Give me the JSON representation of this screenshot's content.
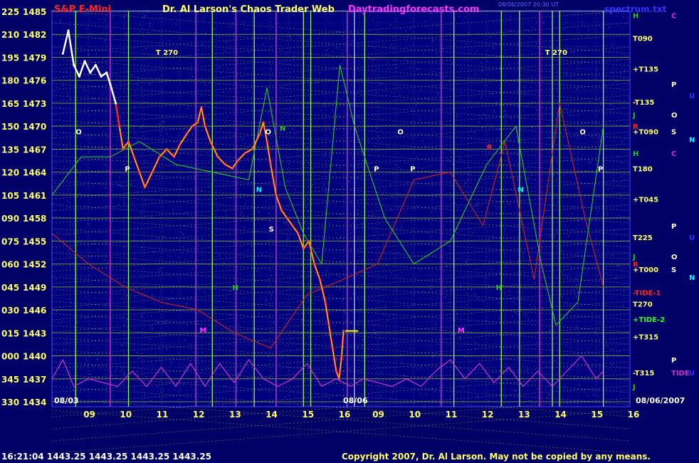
{
  "header": {
    "title_left": "S&P E-Mini",
    "title_center": "Dr. Al Larson's Chaos Trader Web",
    "site": "Daytradingforecasts.com",
    "timestamp": "08/06/2007 20:30 UT",
    "right_label": "spectrum.txt"
  },
  "footer": {
    "quote": "16:21:04  1443.25 1443.25 1443.25 1443.25",
    "copyright": "Copyright 2007, Dr. Al Larson. May not be copied by any means."
  },
  "colors": {
    "background": "#000066",
    "plot_area": "#00007f",
    "grid_horizontal": "#ccff00",
    "grid_vertical_lime": "#88ff44",
    "grid_vertical_magenta": "#cc33cc",
    "price_white": "#ffffff",
    "price_red": "#ff2222",
    "price_yellow": "#ffff00",
    "trace_green": "#22cc22",
    "trace_darkred": "#cc2222",
    "spectrum_magenta": "#cc33cc",
    "title_red": "#ff2222",
    "title_yellow": "#ffff66",
    "site_magenta": "#ff33ff"
  },
  "chart_data": {
    "type": "line",
    "title": "S&P E-Mini",
    "ylim": [
      1434,
      1485
    ],
    "ylabels": [
      {
        "angle": "225",
        "price": "1485",
        "value": 1485
      },
      {
        "angle": "210",
        "price": "1482",
        "value": 1482
      },
      {
        "angle": "195",
        "price": "1479",
        "value": 1479
      },
      {
        "angle": "180",
        "price": "1476",
        "value": 1476
      },
      {
        "angle": "165",
        "price": "1473",
        "value": 1473
      },
      {
        "angle": "150",
        "price": "1470",
        "value": 1470
      },
      {
        "angle": "135",
        "price": "1467",
        "value": 1467
      },
      {
        "angle": "120",
        "price": "1464",
        "value": 1464
      },
      {
        "angle": "105",
        "price": "1461",
        "value": 1461
      },
      {
        "angle": "090",
        "price": "1458",
        "value": 1458
      },
      {
        "angle": "075",
        "price": "1455",
        "value": 1455
      },
      {
        "angle": "060",
        "price": "1452",
        "value": 1452
      },
      {
        "angle": "045",
        "price": "1449",
        "value": 1449
      },
      {
        "angle": "030",
        "price": "1446",
        "value": 1446
      },
      {
        "angle": "015",
        "price": "1443",
        "value": 1443
      },
      {
        "angle": "000",
        "price": "1440",
        "value": 1440
      },
      {
        "angle": "345",
        "price": "1437",
        "value": 1437
      },
      {
        "angle": "330",
        "price": "1434",
        "value": 1434
      }
    ],
    "x_sessions": [
      {
        "date": "08/03",
        "hours": [
          "09",
          "10",
          "11",
          "12",
          "13",
          "14",
          "15",
          "16"
        ]
      },
      {
        "date": "08/06",
        "hours": [
          "09",
          "10",
          "11",
          "12",
          "13",
          "14",
          "15",
          "16"
        ]
      }
    ],
    "x_corner_label": "08/06/2007",
    "last_price": 1443.25,
    "price_series": [
      {
        "t": 8.3,
        "v": 1479.5
      },
      {
        "t": 8.45,
        "v": 1482.5
      },
      {
        "t": 8.6,
        "v": 1478
      },
      {
        "t": 8.75,
        "v": 1476.5
      },
      {
        "t": 8.9,
        "v": 1478.5
      },
      {
        "t": 9.05,
        "v": 1477
      },
      {
        "t": 9.2,
        "v": 1478
      },
      {
        "t": 9.35,
        "v": 1476.5
      },
      {
        "t": 9.5,
        "v": 1477
      },
      {
        "t": 9.6,
        "v": 1475.5
      },
      {
        "t": 9.75,
        "v": 1473
      },
      {
        "t": 9.85,
        "v": 1470
      },
      {
        "t": 9.95,
        "v": 1467
      },
      {
        "t": 10.1,
        "v": 1468
      },
      {
        "t": 10.25,
        "v": 1466
      },
      {
        "t": 10.4,
        "v": 1464
      },
      {
        "t": 10.55,
        "v": 1462
      },
      {
        "t": 10.75,
        "v": 1464
      },
      {
        "t": 10.95,
        "v": 1466
      },
      {
        "t": 11.15,
        "v": 1467
      },
      {
        "t": 11.35,
        "v": 1466
      },
      {
        "t": 11.5,
        "v": 1467.5
      },
      {
        "t": 11.7,
        "v": 1469
      },
      {
        "t": 11.85,
        "v": 1470
      },
      {
        "t": 12.0,
        "v": 1470.5
      },
      {
        "t": 12.1,
        "v": 1472.5
      },
      {
        "t": 12.2,
        "v": 1470
      },
      {
        "t": 12.35,
        "v": 1468
      },
      {
        "t": 12.55,
        "v": 1466
      },
      {
        "t": 12.75,
        "v": 1465
      },
      {
        "t": 12.95,
        "v": 1464.5
      },
      {
        "t": 13.1,
        "v": 1465.5
      },
      {
        "t": 13.3,
        "v": 1466.5
      },
      {
        "t": 13.5,
        "v": 1467
      },
      {
        "t": 13.7,
        "v": 1469
      },
      {
        "t": 13.8,
        "v": 1470.5
      },
      {
        "t": 13.9,
        "v": 1468
      },
      {
        "t": 14.0,
        "v": 1465
      },
      {
        "t": 14.15,
        "v": 1461
      },
      {
        "t": 14.3,
        "v": 1459
      },
      {
        "t": 14.45,
        "v": 1458
      },
      {
        "t": 14.6,
        "v": 1457
      },
      {
        "t": 14.75,
        "v": 1456
      },
      {
        "t": 14.9,
        "v": 1454
      },
      {
        "t": 15.05,
        "v": 1455
      },
      {
        "t": 15.2,
        "v": 1452
      },
      {
        "t": 15.35,
        "v": 1450
      },
      {
        "t": 15.5,
        "v": 1447
      },
      {
        "t": 15.6,
        "v": 1444
      },
      {
        "t": 15.7,
        "v": 1441
      },
      {
        "t": 15.8,
        "v": 1438
      },
      {
        "t": 15.88,
        "v": 1437
      },
      {
        "t": 15.95,
        "v": 1440
      },
      {
        "t": 16.0,
        "v": 1443.25
      }
    ],
    "trace_green": [
      {
        "t": 8.0,
        "v": 1461
      },
      {
        "t": 8.8,
        "v": 1466
      },
      {
        "t": 9.6,
        "v": 1466
      },
      {
        "t": 10.4,
        "v": 1468
      },
      {
        "t": 11.4,
        "v": 1465
      },
      {
        "t": 12.4,
        "v": 1464
      },
      {
        "t": 13.4,
        "v": 1463
      },
      {
        "t": 13.9,
        "v": 1475
      },
      {
        "t": 14.4,
        "v": 1462
      },
      {
        "t": 14.9,
        "v": 1456
      },
      {
        "t": 15.4,
        "v": 1452
      },
      {
        "t": 15.9,
        "v": 1478
      },
      {
        "t": 16.3,
        "v": 1470
      },
      {
        "t": 17.2,
        "v": 1458
      },
      {
        "t": 18.0,
        "v": 1452
      },
      {
        "t": 19.0,
        "v": 1455
      },
      {
        "t": 20.0,
        "v": 1465
      },
      {
        "t": 20.8,
        "v": 1470
      },
      {
        "t": 21.5,
        "v": 1452
      },
      {
        "t": 21.9,
        "v": 1444
      },
      {
        "t": 22.5,
        "v": 1447
      },
      {
        "t": 23.2,
        "v": 1470
      }
    ],
    "trace_darkred": [
      {
        "t": 8.0,
        "v": 1456
      },
      {
        "t": 9.0,
        "v": 1452
      },
      {
        "t": 10.0,
        "v": 1449
      },
      {
        "t": 11.0,
        "v": 1447
      },
      {
        "t": 12.0,
        "v": 1446
      },
      {
        "t": 13.0,
        "v": 1443
      },
      {
        "t": 14.0,
        "v": 1441
      },
      {
        "t": 15.0,
        "v": 1448
      },
      {
        "t": 16.0,
        "v": 1450
      },
      {
        "t": 17.0,
        "v": 1452
      },
      {
        "t": 18.0,
        "v": 1463
      },
      {
        "t": 19.0,
        "v": 1464
      },
      {
        "t": 19.9,
        "v": 1457
      },
      {
        "t": 20.5,
        "v": 1468
      },
      {
        "t": 21.3,
        "v": 1450
      },
      {
        "t": 22.0,
        "v": 1473
      },
      {
        "t": 22.7,
        "v": 1458
      },
      {
        "t": 23.2,
        "v": 1449
      }
    ],
    "spectrum": [
      {
        "t": 8.0,
        "v": 1437
      },
      {
        "t": 8.3,
        "v": 1439.5
      },
      {
        "t": 8.6,
        "v": 1436
      },
      {
        "t": 9.0,
        "v": 1437
      },
      {
        "t": 9.4,
        "v": 1436.5
      },
      {
        "t": 9.8,
        "v": 1436
      },
      {
        "t": 10.2,
        "v": 1438
      },
      {
        "t": 10.6,
        "v": 1436
      },
      {
        "t": 11.0,
        "v": 1438.5
      },
      {
        "t": 11.4,
        "v": 1436
      },
      {
        "t": 11.8,
        "v": 1439
      },
      {
        "t": 12.2,
        "v": 1436
      },
      {
        "t": 12.6,
        "v": 1439
      },
      {
        "t": 13.0,
        "v": 1436.5
      },
      {
        "t": 13.4,
        "v": 1439.5
      },
      {
        "t": 13.8,
        "v": 1437
      },
      {
        "t": 14.2,
        "v": 1436
      },
      {
        "t": 14.6,
        "v": 1437
      },
      {
        "t": 15.0,
        "v": 1439
      },
      {
        "t": 15.4,
        "v": 1436
      },
      {
        "t": 15.8,
        "v": 1437
      },
      {
        "t": 16.2,
        "v": 1436
      },
      {
        "t": 16.6,
        "v": 1437
      },
      {
        "t": 17.0,
        "v": 1436.5
      },
      {
        "t": 17.4,
        "v": 1436
      },
      {
        "t": 17.8,
        "v": 1437
      },
      {
        "t": 18.2,
        "v": 1436
      },
      {
        "t": 18.6,
        "v": 1438
      },
      {
        "t": 19.0,
        "v": 1439.5
      },
      {
        "t": 19.4,
        "v": 1437
      },
      {
        "t": 19.8,
        "v": 1439
      },
      {
        "t": 20.2,
        "v": 1436.5
      },
      {
        "t": 20.6,
        "v": 1438.5
      },
      {
        "t": 21.0,
        "v": 1436
      },
      {
        "t": 21.4,
        "v": 1438
      },
      {
        "t": 21.8,
        "v": 1436
      },
      {
        "t": 22.2,
        "v": 1438
      },
      {
        "t": 22.6,
        "v": 1440
      },
      {
        "t": 23.0,
        "v": 1437
      },
      {
        "t": 23.2,
        "v": 1438
      }
    ],
    "vlines_lime": [
      8.65,
      10.1,
      12.4,
      13.55,
      14.9,
      15.1,
      16.65,
      19.1,
      20.4,
      20.9,
      21.8,
      22.0,
      23.2
    ],
    "vlines_magenta": [
      9.6,
      11.95,
      13.05,
      14.15,
      16.1,
      18.75,
      21.45
    ],
    "right_labels": [
      {
        "text": "H",
        "v": 1484.5,
        "color": "#22cc22",
        "col": 0
      },
      {
        "text": "C",
        "v": 1484.5,
        "color": "#cc33cc",
        "col": 1
      },
      {
        "text": "T090",
        "v": 1481.5,
        "color": "#ffff66",
        "col": 0
      },
      {
        "text": "+T135",
        "v": 1477.5,
        "color": "#ffff66",
        "col": 0
      },
      {
        "text": "P",
        "v": 1475.5,
        "color": "#ffffff",
        "col": 1
      },
      {
        "text": "U",
        "v": 1474,
        "color": "#3333ff",
        "col": 2
      },
      {
        "text": "-T135",
        "v": 1473.2,
        "color": "#ffff66",
        "col": 0
      },
      {
        "text": "J",
        "v": 1471.5,
        "color": "#22cc22",
        "col": 0
      },
      {
        "text": "O",
        "v": 1471.5,
        "color": "#ffffff",
        "col": 1
      },
      {
        "text": "R",
        "v": 1470,
        "color": "#ff2222",
        "col": 0
      },
      {
        "text": "+T090",
        "v": 1469.3,
        "color": "#ffff66",
        "col": 0
      },
      {
        "text": "S",
        "v": 1469.3,
        "color": "#ffffff",
        "col": 1
      },
      {
        "text": "N",
        "v": 1468.3,
        "color": "#00ffff",
        "col": 2
      },
      {
        "text": "H",
        "v": 1466.5,
        "color": "#22cc22",
        "col": 0
      },
      {
        "text": "C",
        "v": 1466.5,
        "color": "#cc33cc",
        "col": 1
      },
      {
        "text": "T180",
        "v": 1464.5,
        "color": "#ffff66",
        "col": 0
      },
      {
        "text": "+T045",
        "v": 1460.5,
        "color": "#ffff66",
        "col": 0
      },
      {
        "text": "P",
        "v": 1457,
        "color": "#ffffff",
        "col": 1
      },
      {
        "text": "U",
        "v": 1455.5,
        "color": "#3333ff",
        "col": 2
      },
      {
        "text": "T225",
        "v": 1455.5,
        "color": "#ffff66",
        "col": 0
      },
      {
        "text": "J",
        "v": 1453,
        "color": "#22cc22",
        "col": 0
      },
      {
        "text": "O",
        "v": 1453,
        "color": "#ffffff",
        "col": 1
      },
      {
        "text": "R",
        "v": 1452,
        "color": "#ff2222",
        "col": 0
      },
      {
        "text": "+T000",
        "v": 1451.3,
        "color": "#ffff66",
        "col": 0
      },
      {
        "text": "S",
        "v": 1451.3,
        "color": "#ffffff",
        "col": 1
      },
      {
        "text": "N",
        "v": 1450.3,
        "color": "#00ffff",
        "col": 2
      },
      {
        "text": "-TIDE-1",
        "v": 1448.3,
        "color": "#ff2222",
        "col": 0
      },
      {
        "text": "T270",
        "v": 1446.8,
        "color": "#ffff66",
        "col": 0
      },
      {
        "text": "+TIDE-2",
        "v": 1444.8,
        "color": "#22ff22",
        "col": 0
      },
      {
        "text": "+T315",
        "v": 1442.5,
        "color": "#ffff66",
        "col": 0
      },
      {
        "text": "P",
        "v": 1439.5,
        "color": "#ffffff",
        "col": 1
      },
      {
        "text": "-T315",
        "v": 1437.8,
        "color": "#ffff66",
        "col": 0
      },
      {
        "text": "TIDE",
        "v": 1437.8,
        "color": "#cc33cc",
        "col": 1
      },
      {
        "text": "U",
        "v": 1437.8,
        "color": "#3333ff",
        "col": 2
      },
      {
        "text": "J",
        "v": 1436,
        "color": "#22cc22",
        "col": 0
      }
    ],
    "in_plot_labels": [
      {
        "text": "T 270",
        "t": 10.85,
        "v": 1479.7,
        "color": "#ffff66"
      },
      {
        "text": "T 270",
        "t": 21.6,
        "v": 1479.7,
        "color": "#ffff66"
      },
      {
        "text": "O",
        "t": 8.65,
        "v": 1469.3,
        "color": "#ffffff"
      },
      {
        "text": "O",
        "t": 13.85,
        "v": 1469.3,
        "color": "#ffffff"
      },
      {
        "text": "O",
        "t": 17.55,
        "v": 1469.3,
        "color": "#ffffff"
      },
      {
        "text": "O",
        "t": 22.55,
        "v": 1469.3,
        "color": "#ffffff"
      },
      {
        "text": "P",
        "t": 10.0,
        "v": 1464.5,
        "color": "#ffffff"
      },
      {
        "text": "P",
        "t": 16.9,
        "v": 1464.5,
        "color": "#ffffff"
      },
      {
        "text": "P",
        "t": 17.9,
        "v": 1464.5,
        "color": "#ffffff"
      },
      {
        "text": "P",
        "t": 23.05,
        "v": 1464.5,
        "color": "#ffffff"
      },
      {
        "text": "N",
        "t": 13.6,
        "v": 1461.8,
        "color": "#00ffff"
      },
      {
        "text": "N",
        "t": 20.85,
        "v": 1461.8,
        "color": "#00ffff"
      },
      {
        "text": "S",
        "t": 13.95,
        "v": 1456.6,
        "color": "#ffffff"
      },
      {
        "text": "M",
        "t": 12.05,
        "v": 1443.4,
        "color": "#ff33ff"
      },
      {
        "text": "M",
        "t": 19.2,
        "v": 1443.4,
        "color": "#ff33ff"
      },
      {
        "text": "R",
        "t": 20.0,
        "v": 1467.3,
        "color": "#ff2222"
      },
      {
        "text": "N",
        "t": 14.25,
        "v": 1469.8,
        "color": "#22cc22"
      },
      {
        "text": "H",
        "t": 12.95,
        "v": 1449,
        "color": "#22cc22"
      },
      {
        "text": "H",
        "t": 20.25,
        "v": 1449,
        "color": "#22cc22"
      }
    ]
  }
}
